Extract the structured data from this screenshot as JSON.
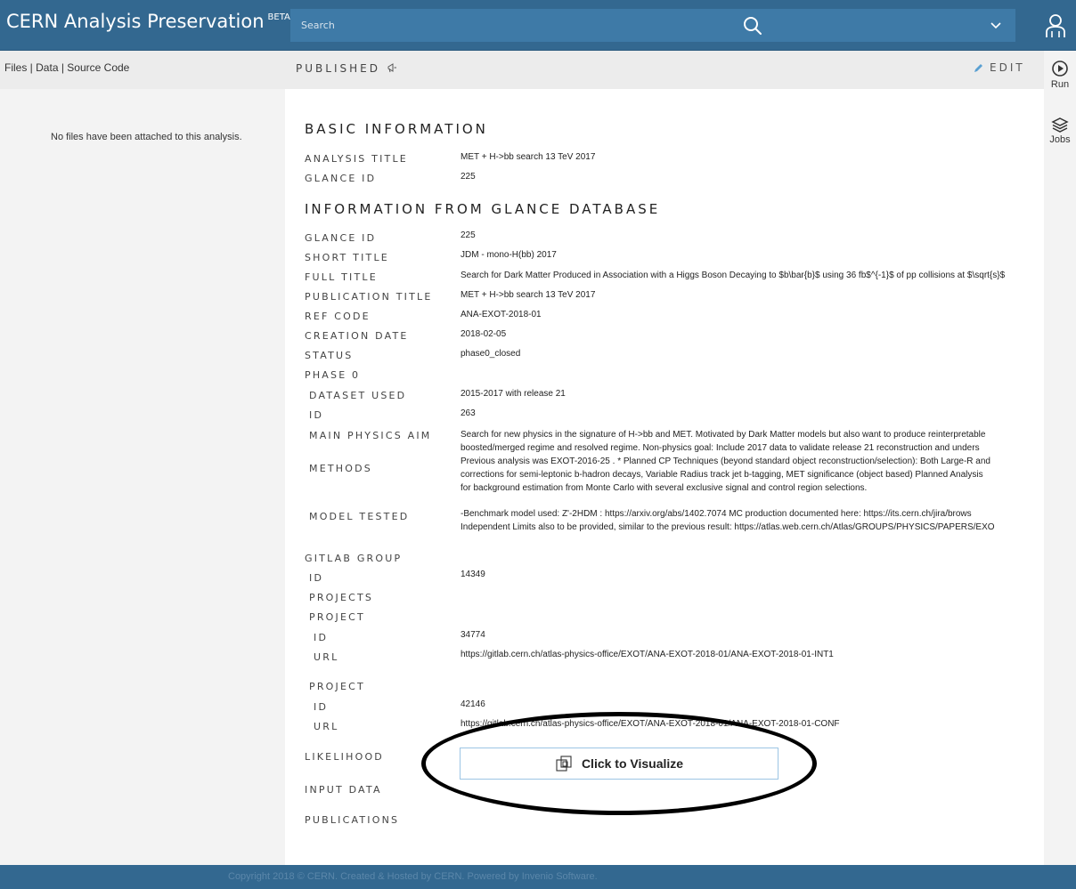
{
  "header": {
    "brand": "CERN Analysis Preservation",
    "beta": "BETA",
    "search_placeholder": "Search"
  },
  "subbar": {
    "tabs": [
      "Files",
      "Data",
      "Source Code"
    ],
    "separator": " | ",
    "status": "PUBLISHED",
    "edit_label": "EDIT"
  },
  "left_panel": {
    "empty_message": "No files have been attached to this analysis."
  },
  "rail": {
    "run_label": "Run",
    "jobs_label": "Jobs"
  },
  "basic": {
    "title": "BASIC INFORMATION",
    "analysis_title_label": "ANALYSIS TITLE",
    "analysis_title": "MET + H->bb search 13 TeV 2017",
    "glance_id_label": "GLANCE ID",
    "glance_id": "225"
  },
  "glance": {
    "title": "INFORMATION FROM GLANCE DATABASE",
    "glance_id_label": "GLANCE ID",
    "glance_id": "225",
    "short_title_label": "SHORT TITLE",
    "short_title": "JDM - mono-H(bb) 2017",
    "full_title_label": "FULL TITLE",
    "full_title": "Search for Dark Matter Produced in Association with a Higgs Boson Decaying to $b\\bar{b}$ using 36 fb$^{-1}$ of pp collisions at $\\sqrt{s}$",
    "publication_title_label": "PUBLICATION TITLE",
    "publication_title": "MET + H->bb search 13 TeV 2017",
    "ref_code_label": "REF CODE",
    "ref_code": "ANA-EXOT-2018-01",
    "creation_date_label": "CREATION DATE",
    "creation_date": "2018-02-05",
    "status_label": "STATUS",
    "status": "phase0_closed",
    "phase0_label": "PHASE 0",
    "dataset_used_label": "DATASET USED",
    "dataset_used": "2015-2017 with release 21",
    "id_label": "ID",
    "id": "263",
    "main_physics_aim_label": "MAIN PHYSICS AIM",
    "methods_label": "METHODS",
    "methods_lines": [
      "Search for new physics in the signature of H->bb and MET. Motivated by Dark Matter models but also want to produce reinterpretable",
      "boosted/merged regime and resolved regime.  Non-physics goal: Include 2017 data to validate release 21 reconstruction and unders",
      "Previous analysis was EXOT-2016-25 .  * Planned CP Techniques (beyond standard object reconstruction/selection): Both Large-R and",
      "corrections for semi-leptonic b-hadron decays, Variable Radius track jet b-tagging, MET significance (object based)  Planned Analysis",
      "for background estimation from Monte Carlo with several exclusive signal and control region selections."
    ],
    "model_tested_label": "MODEL TESTED",
    "model_tested_lines": [
      "-Benchmark model used: Z'-2HDM : https://arxiv.org/abs/1402.7074 MC production documented here: https://its.cern.ch/jira/brows",
      "Independent Limits also to be provided, similar to the previous result: https://atlas.web.cern.ch/Atlas/GROUPS/PHYSICS/PAPERS/EXO"
    ]
  },
  "gitlab": {
    "group_label": "GITLAB GROUP",
    "id_label": "ID",
    "id": "14349",
    "projects_label": "PROJECTS",
    "project_label": "PROJECT",
    "url_label": "URL",
    "projects": [
      {
        "id": "34774",
        "url": "https://gitlab.cern.ch/atlas-physics-office/EXOT/ANA-EXOT-2018-01/ANA-EXOT-2018-01-INT1"
      },
      {
        "id": "42146",
        "url": "https://gitlab.cern.ch/atlas-physics-office/EXOT/ANA-EXOT-2018-01/ANA-EXOT-2018-01-CONF"
      }
    ]
  },
  "extra": {
    "likelihood_label": "LIKELIHOOD",
    "visualize_label": "Click to Visualize",
    "input_data_label": "INPUT DATA",
    "publications_label": "PUBLICATIONS"
  },
  "footer": {
    "text": "Copyright 2018 © CERN. Created & Hosted by CERN. Powered by Invenio Software."
  }
}
